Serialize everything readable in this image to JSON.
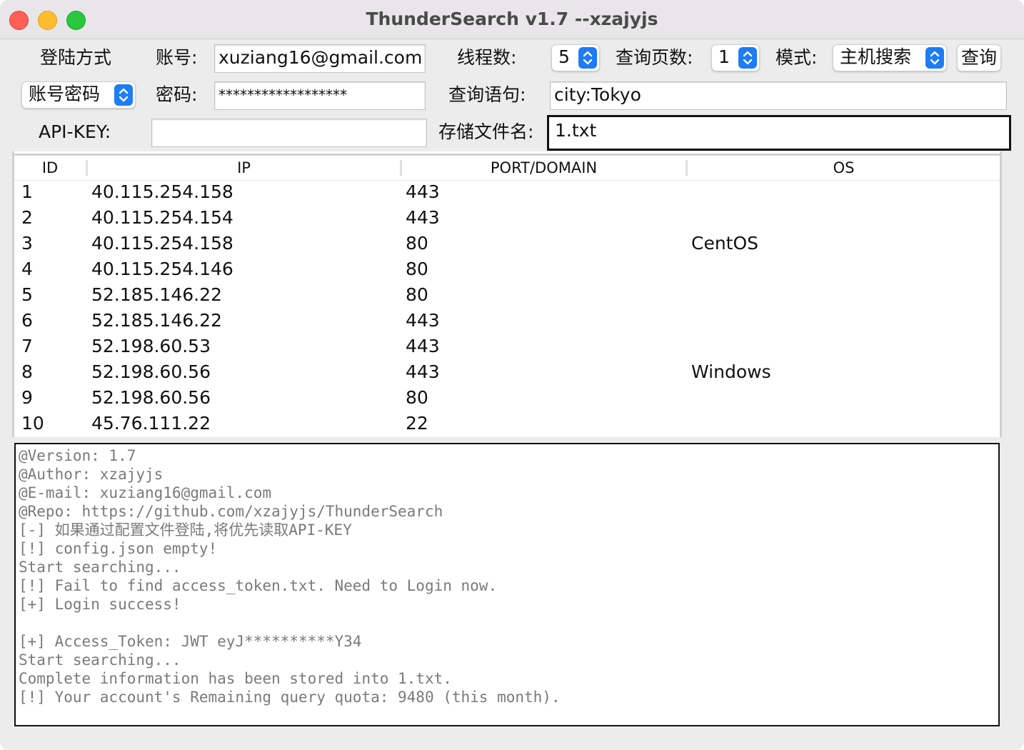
{
  "window": {
    "title": "ThunderSearch v1.7  --xzajyjs"
  },
  "form": {
    "login_method_label": "登陆方式",
    "login_method_value": "账号密码",
    "account_label": "账号:",
    "account_value": "xuziang16@gmail.com",
    "password_label": "密码:",
    "password_value": "******************",
    "apikey_label": "API-KEY:",
    "apikey_value": "",
    "threads_label": "线程数:",
    "threads_value": "5",
    "pages_label": "查询页数:",
    "pages_value": "1",
    "mode_label": "模式:",
    "mode_value": "主机搜索",
    "query_button": "查询",
    "query_label": "查询语句:",
    "query_value": "city:Tokyo",
    "filename_label": "存储文件名:",
    "filename_value": "1.txt"
  },
  "table": {
    "columns": [
      "ID",
      "IP",
      "PORT/DOMAIN",
      "OS"
    ],
    "rows": [
      [
        "1",
        "40.115.254.158",
        "443",
        ""
      ],
      [
        "2",
        "40.115.254.154",
        "443",
        ""
      ],
      [
        "3",
        "40.115.254.158",
        "80",
        "CentOS"
      ],
      [
        "4",
        "40.115.254.146",
        "80",
        ""
      ],
      [
        "5",
        "52.185.146.22",
        "80",
        ""
      ],
      [
        "6",
        "52.185.146.22",
        "443",
        ""
      ],
      [
        "7",
        "52.198.60.53",
        "443",
        ""
      ],
      [
        "8",
        "52.198.60.56",
        "443",
        "Windows"
      ],
      [
        "9",
        "52.198.60.56",
        "80",
        ""
      ],
      [
        "10",
        "45.76.111.22",
        "22",
        ""
      ]
    ]
  },
  "console": {
    "lines": [
      "@Version: 1.7",
      "@Author: xzajyjs",
      "@E-mail: xuziang16@gmail.com",
      "@Repo: https://github.com/xzajyjs/ThunderSearch",
      "[-] 如果通过配置文件登陆,将优先读取API-KEY",
      "[!] config.json empty!",
      "Start searching...",
      "[!] Fail to find access_token.txt. Need to Login now.",
      "[+] Login success!",
      "",
      "[+] Access_Token: JWT eyJ**********Y34",
      "Start searching...",
      "Complete information has been stored into 1.txt.",
      "[!] Your account's Remaining query quota: 9480 (this month)."
    ]
  },
  "colors": {
    "accent": "#1d7cf6",
    "close": "#fe5f57",
    "minimize": "#febc2e",
    "zoom": "#28c840"
  }
}
